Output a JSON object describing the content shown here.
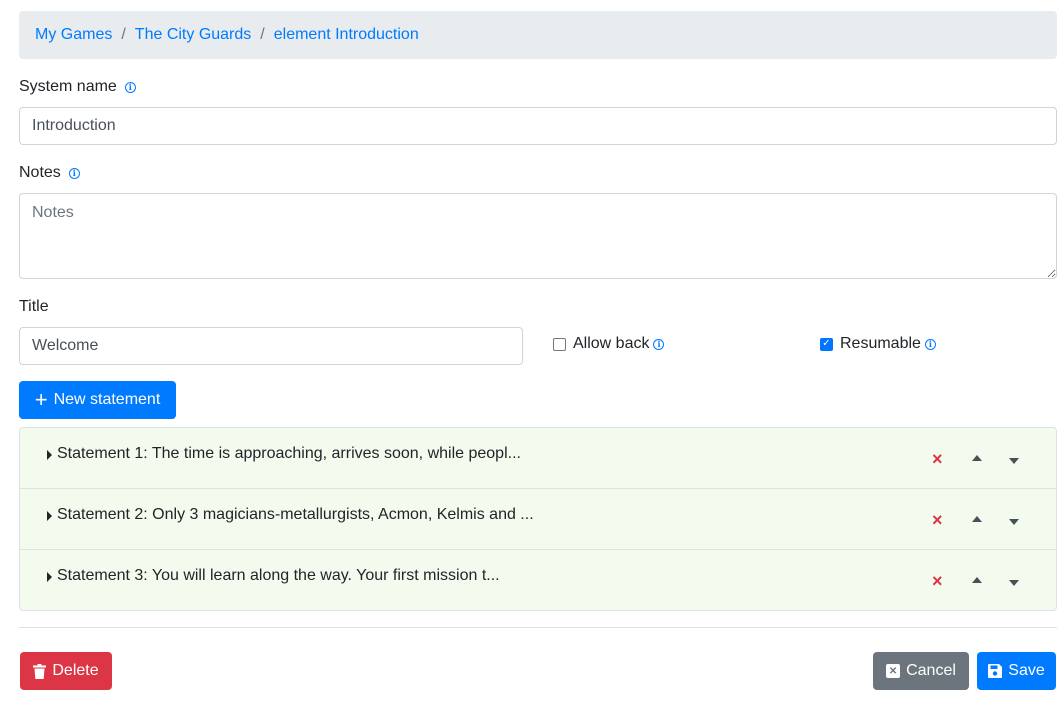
{
  "breadcrumb": {
    "items": [
      "My Games",
      "The City Guards",
      "element Introduction"
    ],
    "separator": "/"
  },
  "form": {
    "system_name": {
      "label": "System name",
      "value": "Introduction"
    },
    "notes": {
      "label": "Notes",
      "placeholder": "Notes",
      "value": ""
    },
    "title": {
      "label": "Title",
      "value": "Welcome"
    },
    "allow_back": {
      "label": "Allow back",
      "checked": false
    },
    "resumable": {
      "label": "Resumable",
      "checked": true,
      "check_glyph": "✓"
    },
    "info_glyph": "i"
  },
  "new_statement_button": {
    "icon": "plus-icon",
    "label": "New statement",
    "glyph": "+"
  },
  "statements": [
    {
      "label": "Statement 1: The time is approaching, arrives soon, while peopl..."
    },
    {
      "label": "Statement 2: Only 3 magicians-metallurgists, Acmon, Kelmis and ..."
    },
    {
      "label": "Statement 3: You will learn along the way. Your first mission t..."
    }
  ],
  "statement_delete_glyph": "×",
  "footer": {
    "delete_label": "Delete",
    "cancel_label": "Cancel",
    "save_label": "Save",
    "cancel_glyph": "✕"
  },
  "colors": {
    "primary": "#007bff",
    "danger": "#dc3545",
    "secondary": "#6c757d",
    "list_bg": "#f3fbee"
  }
}
